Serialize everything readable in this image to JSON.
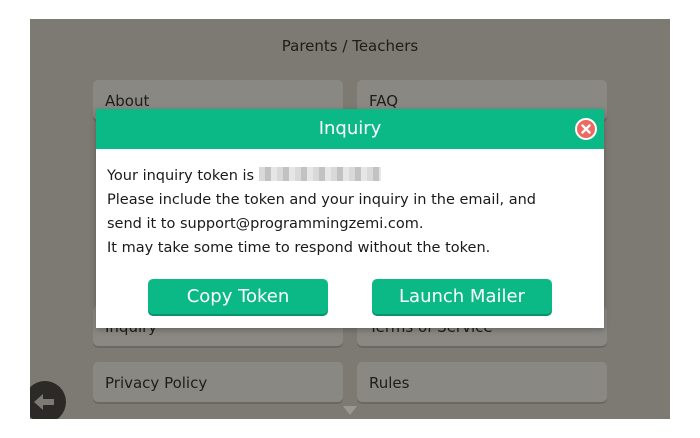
{
  "screen": {
    "title": "Parents / Teachers"
  },
  "menu": {
    "items": [
      {
        "label": "About"
      },
      {
        "label": "FAQ"
      },
      {
        "label": "Inquiry"
      },
      {
        "label": "Terms of Service"
      },
      {
        "label": "Privacy Policy"
      },
      {
        "label": "Rules"
      }
    ]
  },
  "icons": {
    "back": "back-arrow-icon",
    "close": "close-icon",
    "scroll": "chevron-down-icon"
  },
  "colors": {
    "accent": "#0bb987",
    "close": "#ee6960",
    "overlay": "#7c7a72",
    "menu_button": "#8a8883"
  },
  "dialog": {
    "title": "Inquiry",
    "token_prefix": "Your inquiry token is",
    "line2": "Please include the token and your inquiry in the email, and",
    "line3": "send it to support@programmingzemi.com.",
    "line4": "It may take some time to respond without the token.",
    "copy_label": "Copy Token",
    "mailer_label": "Launch Mailer"
  }
}
